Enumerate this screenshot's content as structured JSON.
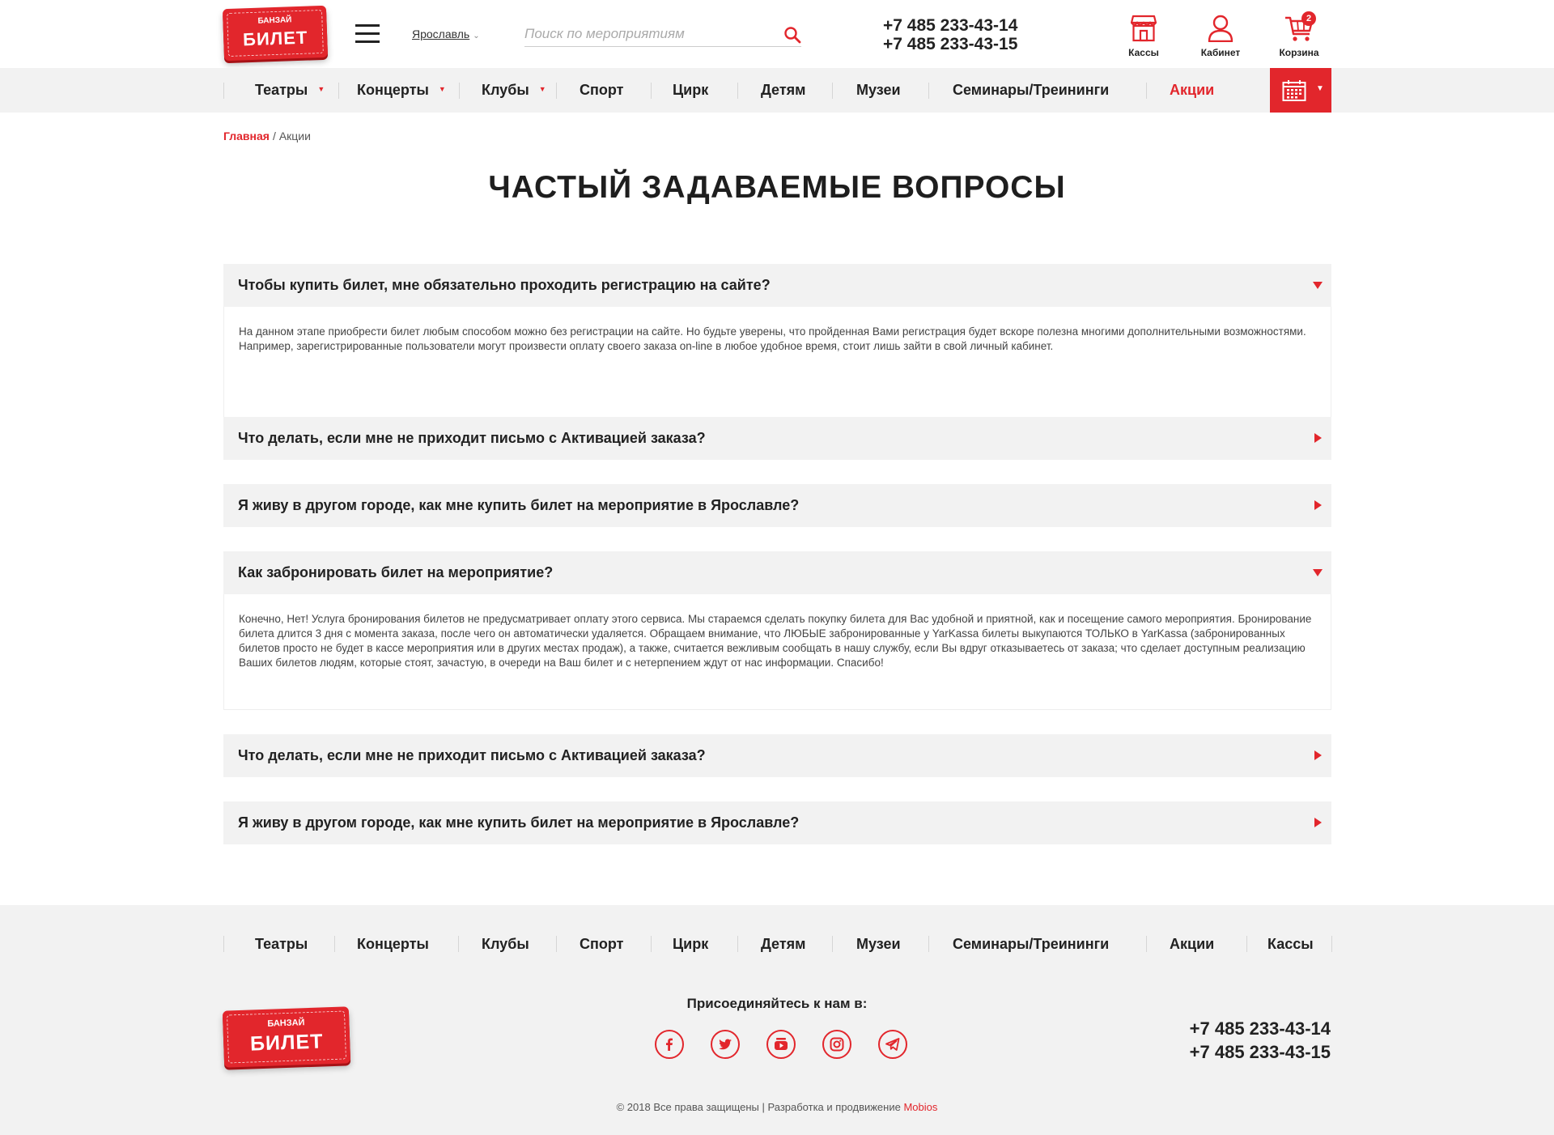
{
  "header": {
    "logo": {
      "top": "БАНЗАЙ",
      "main": "БИЛЕТ"
    },
    "city": "Ярославль",
    "search_placeholder": "Поиск по мероприятиям",
    "phones": [
      "+7 485 233-43-14",
      "+7 485 233-43-15"
    ],
    "icons": [
      {
        "label": "Кассы",
        "icon": "store-icon"
      },
      {
        "label": "Кабинет",
        "icon": "user-icon"
      },
      {
        "label": "Корзина",
        "icon": "cart-icon",
        "badge": "2"
      }
    ]
  },
  "nav": {
    "items": [
      {
        "label": "Театры",
        "dropdown": true
      },
      {
        "label": "Концерты",
        "dropdown": true
      },
      {
        "label": "Клубы",
        "dropdown": true
      },
      {
        "label": "Спорт"
      },
      {
        "label": "Цирк"
      },
      {
        "label": "Детям"
      },
      {
        "label": "Музеи"
      },
      {
        "label": "Семинары/Треининги"
      },
      {
        "label": "Акции",
        "active": true
      }
    ],
    "calendar_icon": "calendar-icon"
  },
  "breadcrumb": {
    "home": "Главная",
    "separator": "/",
    "current": "Акции"
  },
  "page_title": "ЧАСТЫЙ ЗАДАВАЕМЫЕ ВОПРОСЫ",
  "faq": [
    {
      "question": "Чтобы купить билет, мне обязательно проходить регистрацию на сайте?",
      "open": true,
      "answer": "На данном этапе приобрести билет любым способом можно без регистрации на сайте. Но будьте уверены, что  пройденная Вами регистрация будет вскоре полезна многими дополнительными возможностями. Например, зарегистрированные пользователи могут произвести оплату своего заказа on-line в любое удобное время, стоит лишь зайти в свой личный кабинет."
    },
    {
      "question": "Что делать, если мне не приходит письмо с Активацией заказа?",
      "open": false
    },
    {
      "question": "Я живу в другом городе, как мне купить билет на мероприятие в Ярославле?",
      "open": false
    },
    {
      "question": "Как забронировать билет на мероприятие?",
      "open": true,
      "answer": "Конечно, Нет! Услуга бронирования билетов не предусматривает оплату этого сервиса. Мы стараемся сделать покупку билета для Вас удобной и приятной, как и посещение самого мероприятия. Бронирование билета длится 3 дня с момента заказа, после чего он автоматически удаляется. Обращаем внимание, что ЛЮБЫЕ забронированные у YarKassa билеты выкупаются ТОЛЬКО в YarKassa (забронированных билетов просто не будет в кассе мероприятия или в других местах продаж), а также, считается вежливым сообщать в нашу службу, если Вы вдруг отказываетесь от заказа; что сделает доступным реализацию Ваших билетов людям, которые стоят, зачастую, в очереди на Ваш билет и с нетерпением ждут от нас информации. Спасибо!"
    },
    {
      "question": "Что делать, если мне не приходит письмо с Активацией заказа?",
      "open": false
    },
    {
      "question": "Я живу в другом городе, как мне купить билет на мероприятие в Ярославле?",
      "open": false
    }
  ],
  "footer": {
    "nav": [
      "Театры",
      "Концерты",
      "Клубы",
      "Спорт",
      "Цирк",
      "Детям",
      "Музеи",
      "Семинары/Треининги",
      "Акции",
      "Кассы"
    ],
    "join_label": "Присоединяйтесь к нам в:",
    "social": [
      "facebook-icon",
      "twitter-icon",
      "youtube-icon",
      "instagram-icon",
      "telegram-icon"
    ],
    "phones": [
      "+7 485 233-43-14",
      "+7 485 233-43-15"
    ],
    "copyright": "© 2018 Все права защищены | Разработка и продвижение",
    "developer": "Mobios"
  },
  "colors": {
    "accent": "#e2262c",
    "nav_bg": "#f2f2f2",
    "text": "#222222"
  }
}
